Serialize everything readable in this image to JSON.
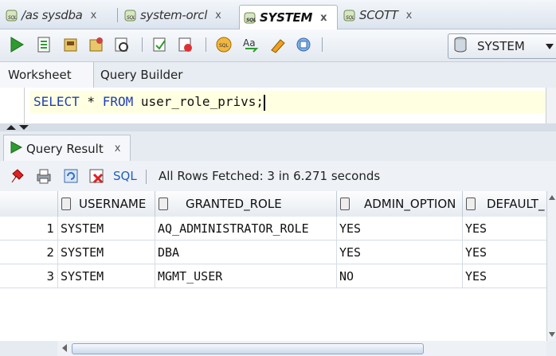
{
  "connection_tabs": [
    {
      "label": "/as sysdba",
      "close": "x"
    },
    {
      "label": "system-orcl",
      "close": "x"
    },
    {
      "label": "SYSTEM",
      "close": "x"
    },
    {
      "label": "SCOTT",
      "close": "x"
    }
  ],
  "connection_selector": {
    "value": "SYSTEM"
  },
  "worksheet_tabs": [
    "Worksheet",
    "Query Builder"
  ],
  "editor": {
    "kw1": "SELECT",
    "mid": " * ",
    "kw2": "FROM",
    "rest": " user_role_privs;"
  },
  "result_tab": {
    "label": "Query Result",
    "close": "x"
  },
  "result_toolbar": {
    "sql_label": "SQL",
    "status": "All Rows Fetched: 3 in 6.271 seconds"
  },
  "grid": {
    "columns": [
      "USERNAME",
      "GRANTED_ROLE",
      "ADMIN_OPTION",
      "DEFAULT_"
    ],
    "rows": [
      {
        "n": "1",
        "cells": [
          "SYSTEM",
          "AQ_ADMINISTRATOR_ROLE",
          "YES",
          "YES"
        ]
      },
      {
        "n": "2",
        "cells": [
          "SYSTEM",
          "DBA",
          "YES",
          "YES"
        ]
      },
      {
        "n": "3",
        "cells": [
          "SYSTEM",
          "MGMT_USER",
          "NO",
          "YES"
        ]
      }
    ]
  },
  "colors": {
    "keyword": "#1f3fb7",
    "editor_line": "#ffffe1",
    "run_green": "#2e9b2e"
  }
}
